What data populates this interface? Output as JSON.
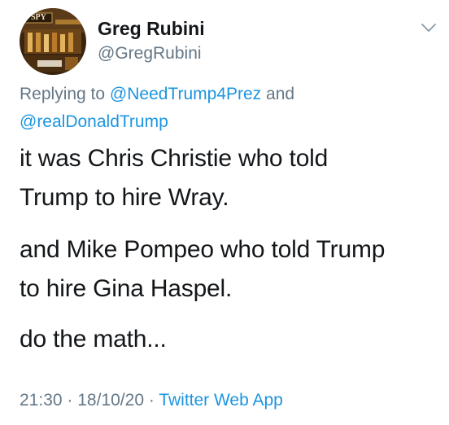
{
  "author": {
    "display_name": "Greg Rubini",
    "handle": "@GregRubini",
    "avatar_text": "SPY"
  },
  "reply": {
    "prefix": "Replying to",
    "mention_1": "@NeedTrump4Prez",
    "joiner": "and",
    "mention_2": "@realDonaldTrump"
  },
  "tweet": {
    "line_1": "it was Chris Christie who told",
    "line_2": "Trump to hire Wray.",
    "line_3": "and Mike Pompeo who told Trump",
    "line_4": "to hire Gina Haspel.",
    "line_5": "do the math..."
  },
  "meta": {
    "time": "21:30",
    "sep_1": "·",
    "date": "18/10/20",
    "sep_2": "·",
    "source": "Twitter Web App"
  },
  "icons": {
    "menu": "chevron-down-icon"
  },
  "colors": {
    "link": "#1b95e0",
    "secondary": "#657786",
    "text": "#14171a"
  }
}
